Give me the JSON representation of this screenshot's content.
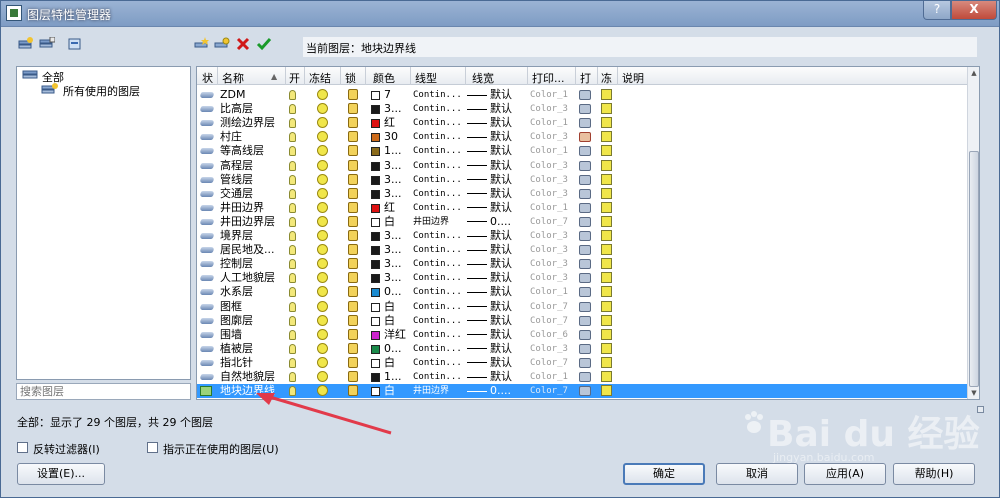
{
  "window": {
    "title": "图层特性管理器",
    "help_glyph": "?",
    "close_glyph": "X"
  },
  "current_layer": {
    "label": "当前图层：地块边界线"
  },
  "tree": {
    "all": "全部",
    "used": "所有使用的图层"
  },
  "search": {
    "placeholder": "搜索图层"
  },
  "columns": [
    "状",
    "名称",
    "开",
    "冻结",
    "锁",
    "颜色",
    "线型",
    "线宽",
    "打印...",
    "打",
    "冻",
    "说明"
  ],
  "sort_glyph": "▲",
  "layers": [
    {
      "name": "ZDM",
      "color": "#ffffff",
      "color_label": "7",
      "linetype": "Contin...",
      "lineweight": "默认",
      "plot_style": "Color_1",
      "plot": true
    },
    {
      "name": "比高层",
      "color": "#1a1a1a",
      "color_label": "3...",
      "linetype": "Contin...",
      "lineweight": "默认",
      "plot_style": "Color_3",
      "plot": true
    },
    {
      "name": "测绘边界层",
      "color": "#dd1111",
      "color_label": "红",
      "linetype": "Contin...",
      "lineweight": "默认",
      "plot_style": "Color_1",
      "plot": true
    },
    {
      "name": "村庄",
      "color": "#cc6a1a",
      "color_label": "30",
      "linetype": "Contin...",
      "lineweight": "默认",
      "plot_style": "Color_3",
      "plot": false
    },
    {
      "name": "等高线层",
      "color": "#8a6a1a",
      "color_label": "1...",
      "linetype": "Contin...",
      "lineweight": "默认",
      "plot_style": "Color_1",
      "plot": true
    },
    {
      "name": "高程层",
      "color": "#1a1a1a",
      "color_label": "3...",
      "linetype": "Contin...",
      "lineweight": "默认",
      "plot_style": "Color_3",
      "plot": true
    },
    {
      "name": "管线层",
      "color": "#1a1a1a",
      "color_label": "3...",
      "linetype": "Contin...",
      "lineweight": "默认",
      "plot_style": "Color_3",
      "plot": true
    },
    {
      "name": "交通层",
      "color": "#1a1a1a",
      "color_label": "3...",
      "linetype": "Contin...",
      "lineweight": "默认",
      "plot_style": "Color_3",
      "plot": true
    },
    {
      "name": "井田边界",
      "color": "#dd1111",
      "color_label": "红",
      "linetype": "Contin...",
      "lineweight": "默认",
      "plot_style": "Color_1",
      "plot": true
    },
    {
      "name": "井田边界层",
      "color": "#ffffff",
      "color_label": "白",
      "linetype": "井田边界",
      "lineweight": "0....",
      "plot_style": "Color_7",
      "plot": true
    },
    {
      "name": "境界层",
      "color": "#1a1a1a",
      "color_label": "3...",
      "linetype": "Contin...",
      "lineweight": "默认",
      "plot_style": "Color_3",
      "plot": true
    },
    {
      "name": "居民地及...",
      "color": "#1a1a1a",
      "color_label": "3...",
      "linetype": "Contin...",
      "lineweight": "默认",
      "plot_style": "Color_3",
      "plot": true
    },
    {
      "name": "控制层",
      "color": "#1a1a1a",
      "color_label": "3...",
      "linetype": "Contin...",
      "lineweight": "默认",
      "plot_style": "Color_3",
      "plot": true
    },
    {
      "name": "人工地貌层",
      "color": "#1a1a1a",
      "color_label": "3...",
      "linetype": "Contin...",
      "lineweight": "默认",
      "plot_style": "Color_3",
      "plot": true
    },
    {
      "name": "水系层",
      "color": "#1a8ad0",
      "color_label": "0...",
      "linetype": "Contin...",
      "lineweight": "默认",
      "plot_style": "Color_1",
      "plot": true
    },
    {
      "name": "图框",
      "color": "#ffffff",
      "color_label": "白",
      "linetype": "Contin...",
      "lineweight": "默认",
      "plot_style": "Color_7",
      "plot": true
    },
    {
      "name": "图廓层",
      "color": "#ffffff",
      "color_label": "白",
      "linetype": "Contin...",
      "lineweight": "默认",
      "plot_style": "Color_7",
      "plot": true
    },
    {
      "name": "围墙",
      "color": "#cc22cc",
      "color_label": "洋红",
      "linetype": "Contin...",
      "lineweight": "默认",
      "plot_style": "Color_6",
      "plot": true
    },
    {
      "name": "植被层",
      "color": "#1a8a4a",
      "color_label": "0...",
      "linetype": "Contin...",
      "lineweight": "默认",
      "plot_style": "Color_3",
      "plot": true
    },
    {
      "name": "指北针",
      "color": "#ffffff",
      "color_label": "白",
      "linetype": "Contin...",
      "lineweight": "默认",
      "plot_style": "Color_7",
      "plot": true
    },
    {
      "name": "自然地貌层",
      "color": "#1a1a1a",
      "color_label": "1...",
      "linetype": "Contin...",
      "lineweight": "默认",
      "plot_style": "Color_1",
      "plot": true
    },
    {
      "name": "地块边界线",
      "color": "#ffffff",
      "color_label": "白",
      "linetype": "井田边界",
      "lineweight": "0....",
      "plot_style": "Color_7",
      "plot": true,
      "selected": true
    }
  ],
  "status": "全部：显示了 29 个图层，共 29 个图层",
  "filters": {
    "invert": "反转过滤器(I)",
    "indicate_used": "指示正在使用的图层(U)"
  },
  "buttons": {
    "settings": "设置(E)...",
    "ok": "确定",
    "cancel": "取消",
    "apply": "应用(A)",
    "help": "帮助(H)"
  },
  "watermark": {
    "brand": "Bai du 经验",
    "url": "jingyan.baidu.com"
  },
  "colors": {
    "selection": "#3399ff",
    "arrow": "#e23a4a"
  }
}
